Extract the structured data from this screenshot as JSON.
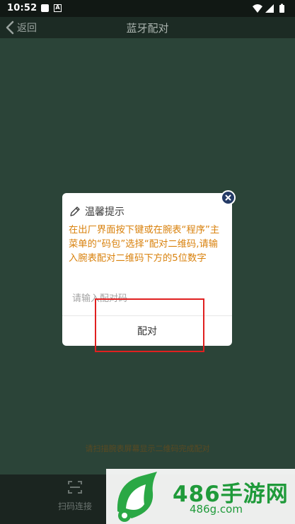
{
  "status_bar": {
    "time": "10:52",
    "letter_icon": "A"
  },
  "nav": {
    "back_label": "返回",
    "title": "蓝牙配对"
  },
  "page": {
    "hint": "请扫描腕表屏幕显示二维码完成配对"
  },
  "bottom": {
    "scan_label": "扫码连接"
  },
  "watermark": {
    "title": "486手游网",
    "subtitle": "486g.com"
  },
  "dialog": {
    "title": "温馨提示",
    "message": "在出厂界面按下键或在腕表“程序”主菜单的“码包”选择“配对二维码,请输入腕表配对二维码下方的5位数字",
    "input_placeholder": "请输入配对码",
    "input_value": "",
    "confirm_label": "配对"
  },
  "colors": {
    "background": "#2b4438",
    "message_text": "#d9820e",
    "close_button": "#243a66",
    "highlight_box": "#e02020",
    "watermark_green": "#1f9a3a"
  },
  "icons": [
    "back-chevron-icon",
    "pencil-icon",
    "close-icon",
    "scan-icon",
    "wifi-icon",
    "signal-icon",
    "battery-icon",
    "logo-icon"
  ]
}
